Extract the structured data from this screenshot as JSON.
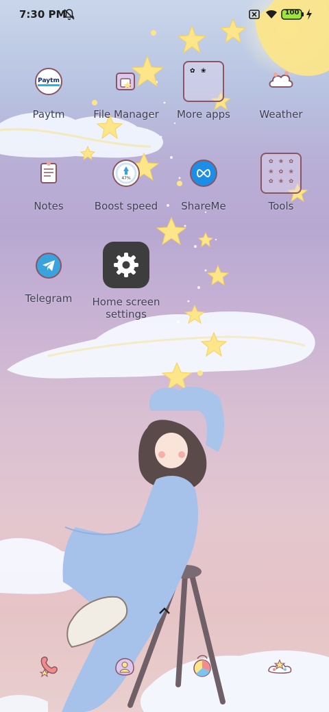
{
  "status": {
    "time": "7:30 PM",
    "battery": "100"
  },
  "apps": [
    {
      "label": "Paytm",
      "icon": "paytm-icon"
    },
    {
      "label": "File Manager",
      "icon": "file-manager-icon"
    },
    {
      "label": "More apps",
      "icon": "folder-icon"
    },
    {
      "label": "Weather",
      "icon": "weather-icon"
    },
    {
      "label": "Notes",
      "icon": "notes-icon"
    },
    {
      "label": "Boost speed",
      "icon": "boost-icon",
      "badge": "47%"
    },
    {
      "label": "ShareMe",
      "icon": "shareme-icon"
    },
    {
      "label": "Tools",
      "icon": "folder-icon"
    },
    {
      "label": "Telegram",
      "icon": "telegram-icon"
    },
    {
      "label": "Home screen\nsettings",
      "icon": "gear-icon"
    }
  ],
  "paytm_logo": "Paytm",
  "dock": [
    "phone-icon",
    "contacts-icon",
    "browser-icon",
    "gallery-icon"
  ],
  "colors": {
    "label": "#3f3f55",
    "folder_border": "#8a5560",
    "battery": "#9ee63a",
    "shareme": "#1c8ee8",
    "telegram": "#3aa3dd",
    "settings_tile": "#3d3d3d"
  }
}
